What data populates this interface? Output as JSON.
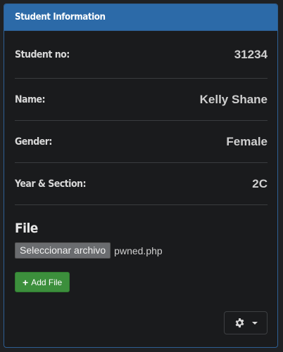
{
  "panel": {
    "title": "Student Information"
  },
  "student": {
    "rows": [
      {
        "label": "Student no:",
        "value": "31234"
      },
      {
        "label": "Name:",
        "value": "Kelly Shane"
      },
      {
        "label": "Gender:",
        "value": "Female"
      },
      {
        "label": "Year & Section:",
        "value": "2C"
      }
    ]
  },
  "file": {
    "heading": "File",
    "choose_label": "Seleccionar archivo",
    "selected_name": "pwned.php",
    "add_label": "Add File"
  },
  "actions": {
    "icon": "gear-icon",
    "caret": "caret-down-icon"
  },
  "colors": {
    "heading_bg": "#2c6aa8",
    "add_button": "#3c8f3c",
    "panel_bg": "#1a1b1d"
  }
}
